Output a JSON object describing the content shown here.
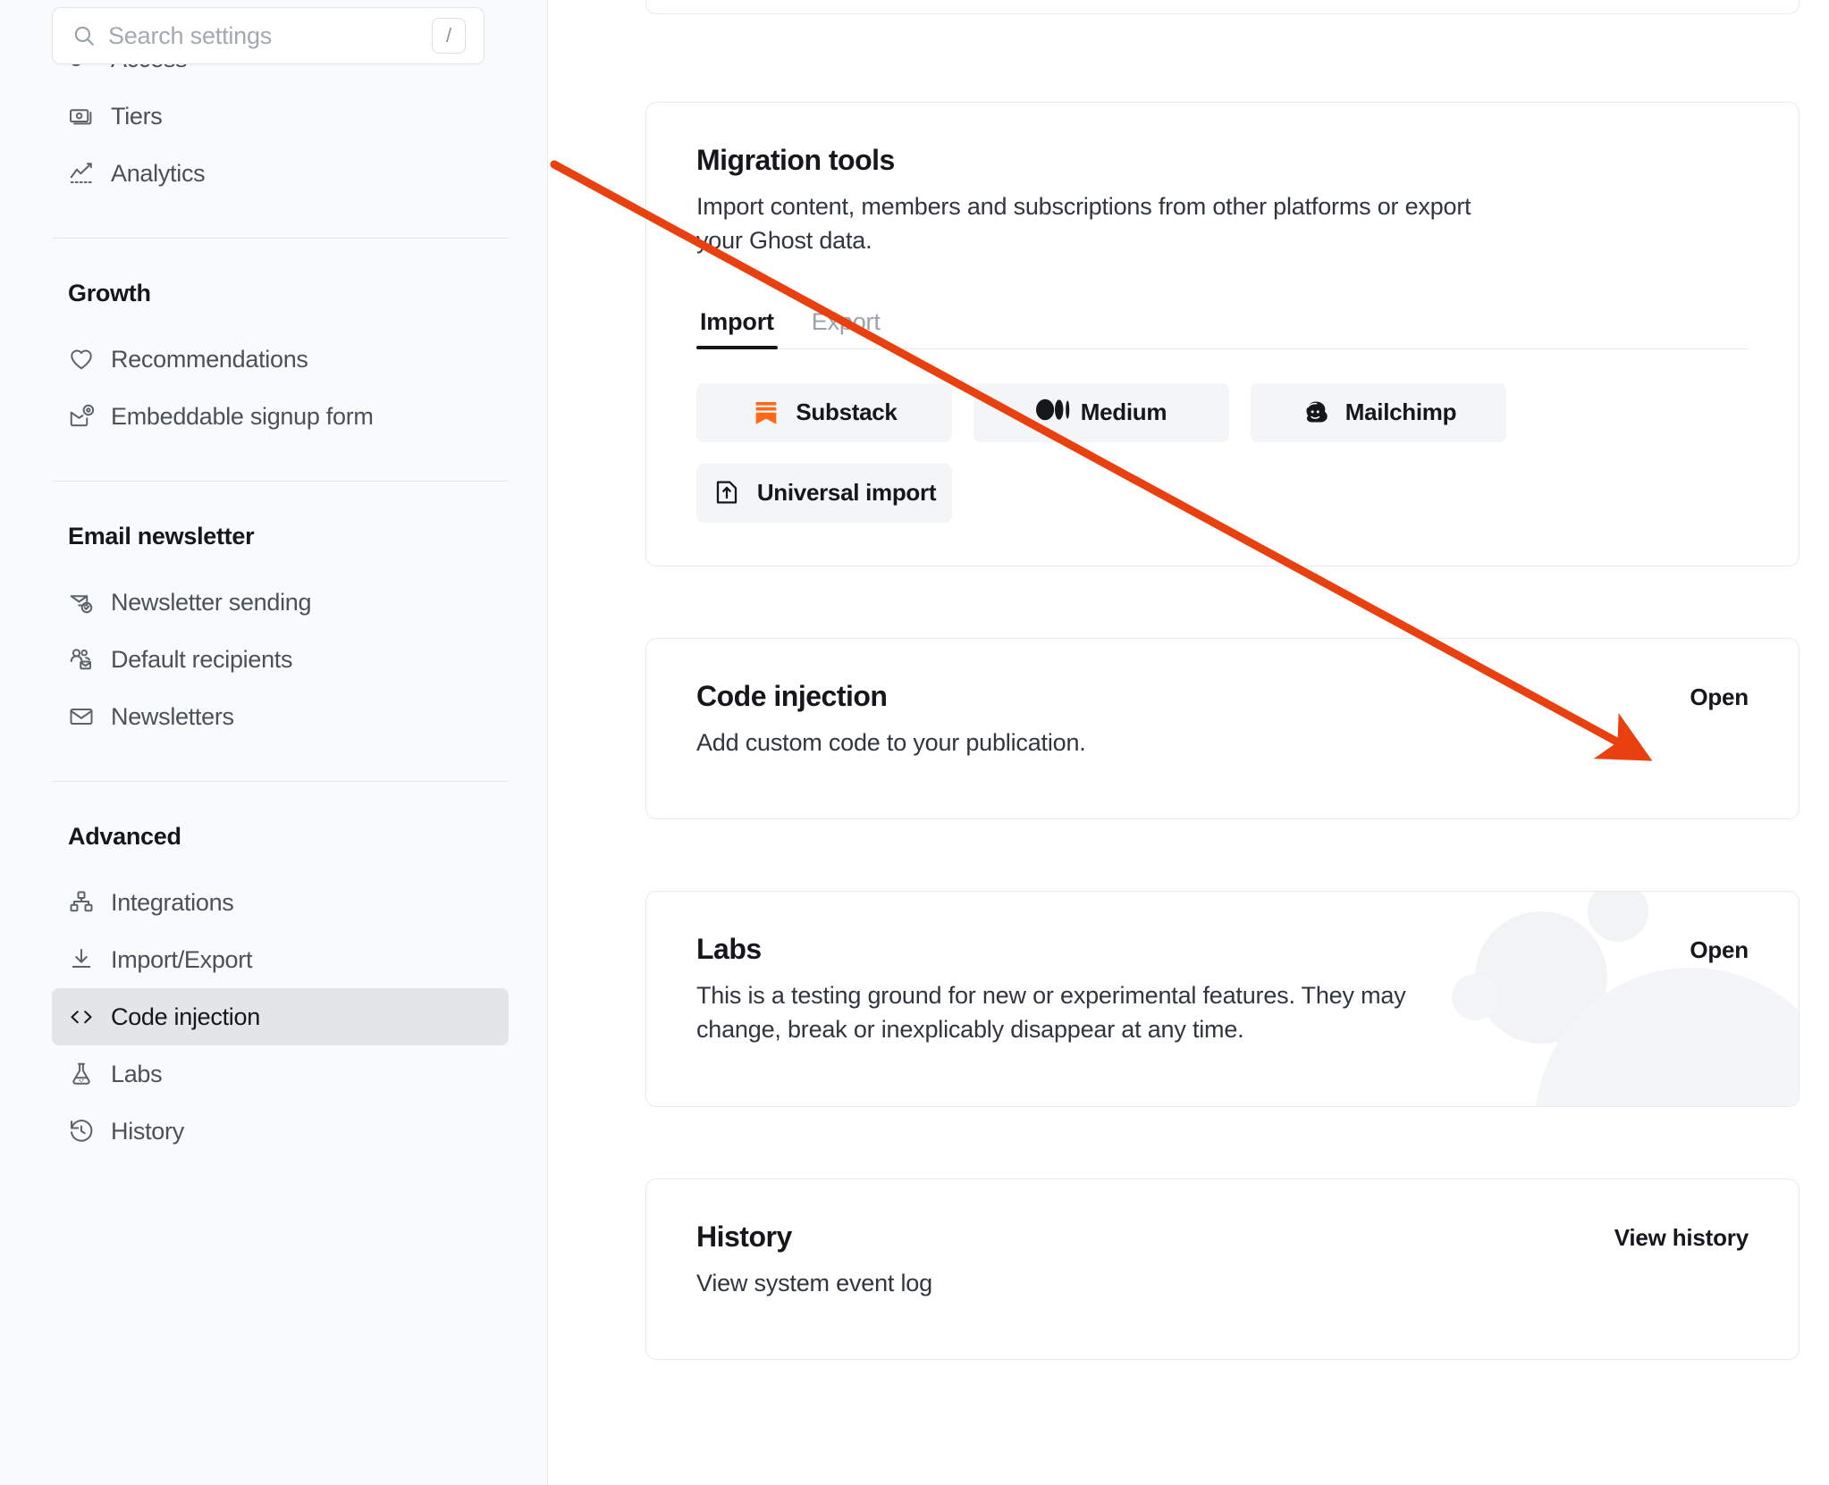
{
  "search": {
    "placeholder": "Search settings",
    "value": "",
    "shortcut": "/",
    "icon": "search-icon"
  },
  "sidebar": {
    "groups": [
      {
        "title": "",
        "items": [
          {
            "label": "Access",
            "icon": "key-icon",
            "active": false
          },
          {
            "label": "Tiers",
            "icon": "money-icon",
            "active": false
          },
          {
            "label": "Analytics",
            "icon": "chart-line-icon",
            "active": false
          }
        ]
      },
      {
        "title": "Growth",
        "items": [
          {
            "label": "Recommendations",
            "icon": "heart-icon",
            "active": false
          },
          {
            "label": "Embeddable signup form",
            "icon": "signup-form-icon",
            "active": false
          }
        ]
      },
      {
        "title": "Email newsletter",
        "items": [
          {
            "label": "Newsletter sending",
            "icon": "mail-check-icon",
            "active": false
          },
          {
            "label": "Default recipients",
            "icon": "users-mail-icon",
            "active": false
          },
          {
            "label": "Newsletters",
            "icon": "envelope-icon",
            "active": false
          }
        ]
      },
      {
        "title": "Advanced",
        "items": [
          {
            "label": "Integrations",
            "icon": "blocks-icon",
            "active": false
          },
          {
            "label": "Import/Export",
            "icon": "download-icon",
            "active": false
          },
          {
            "label": "Code injection",
            "icon": "code-brackets-icon",
            "active": true
          },
          {
            "label": "Labs",
            "icon": "flask-icon",
            "active": false
          },
          {
            "label": "History",
            "icon": "clock-rewind-icon",
            "active": false
          }
        ]
      }
    ]
  },
  "main": {
    "migration": {
      "title": "Migration tools",
      "description": "Import content, members and subscriptions from other platforms or export your Ghost data.",
      "tabs": [
        {
          "label": "Import",
          "active": true
        },
        {
          "label": "Export",
          "active": false
        }
      ],
      "import_options": [
        {
          "label": "Substack",
          "icon": "substack-icon"
        },
        {
          "label": "Medium",
          "icon": "medium-icon"
        },
        {
          "label": "Mailchimp",
          "icon": "mailchimp-icon"
        },
        {
          "label": "Universal import",
          "icon": "file-upload-icon"
        }
      ]
    },
    "code_injection": {
      "title": "Code injection",
      "description": "Add custom code to your publication.",
      "action_label": "Open"
    },
    "labs": {
      "title": "Labs",
      "description": "This is a testing ground for new or experimental features. They may change, break or inexplicably disappear at any time.",
      "action_label": "Open"
    },
    "history": {
      "title": "History",
      "description": "View system event log",
      "action_label": "View history"
    }
  },
  "annotation": {
    "arrow_color": "#e8410f",
    "target": "code-injection-open-link"
  },
  "colors": {
    "accent": "#e8410f",
    "sidebar_bg": "#f9fafb",
    "active_item_bg": "#e3e5e8",
    "text_primary": "#15171a",
    "text_secondary": "#4a5159",
    "substack_orange": "#ff6719"
  }
}
